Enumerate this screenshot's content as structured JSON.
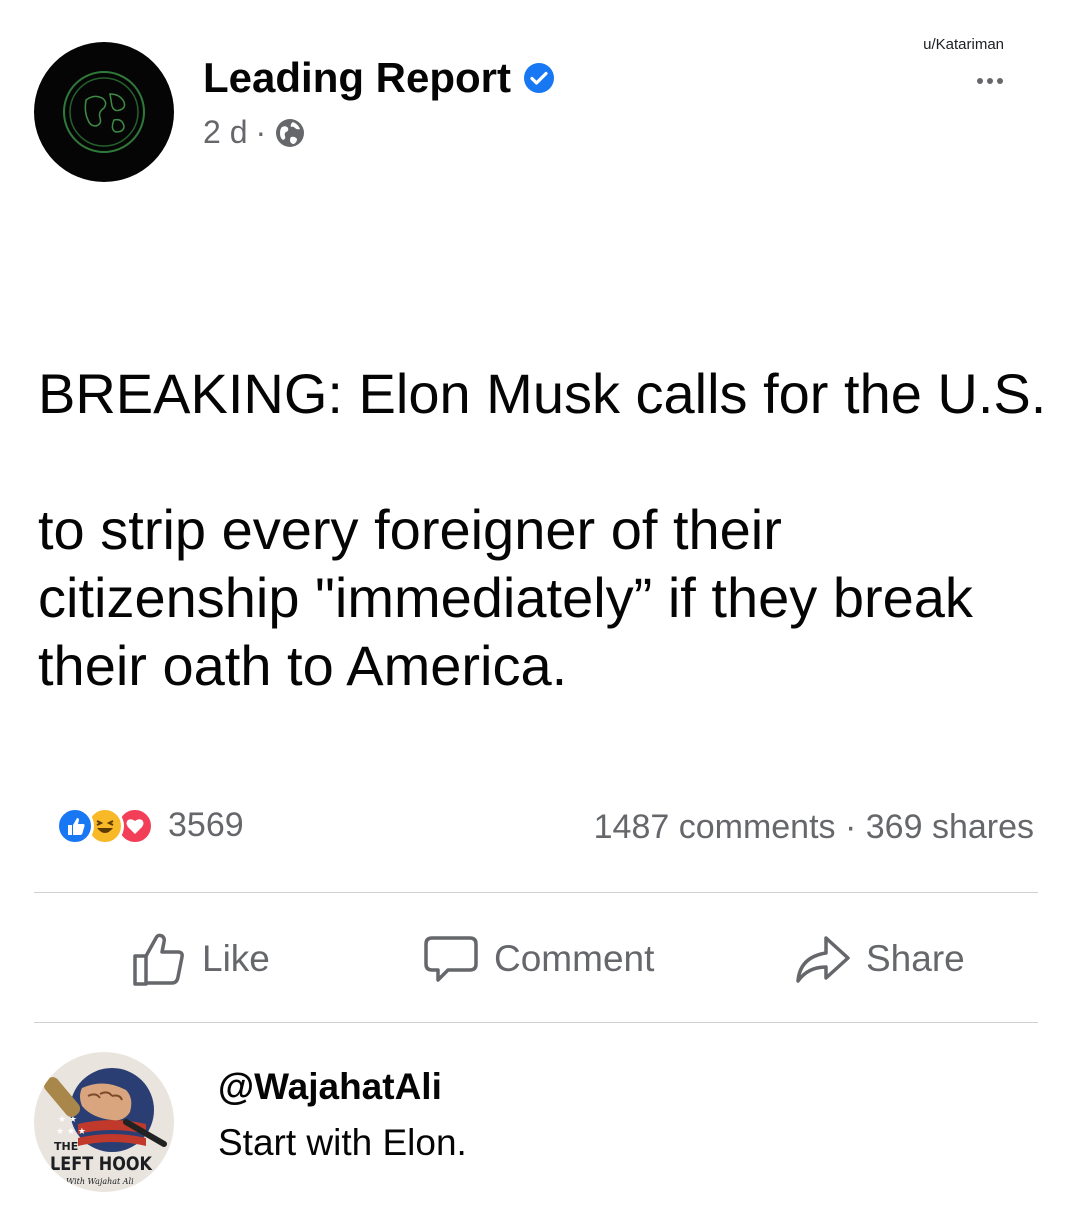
{
  "watermark": "u/Katariman",
  "post": {
    "page_name": "Leading Report",
    "verified": true,
    "time": "2 d",
    "separator": "·",
    "privacy_icon": "globe-icon",
    "text": "BREAKING: Elon Musk calls for the U.S.\n\nto strip every foreigner of their citizenship \"immediately” if they break their oath to America."
  },
  "engagement": {
    "reaction_icons": [
      "like-reaction-icon",
      "haha-reaction-icon",
      "love-reaction-icon"
    ],
    "reaction_count": "3569",
    "comments": "1487 comments",
    "stats_separator": " · ",
    "shares": "369 shares"
  },
  "actions": {
    "like": "Like",
    "comment": "Comment",
    "share": "Share"
  },
  "comment": {
    "handle": "@WajahatAli",
    "text": "Start with Elon.",
    "avatar_logo_lines": [
      "THE",
      "LEFT HOOK",
      "With Wajahat Ali"
    ]
  },
  "colors": {
    "brand_blue": "#1877f2",
    "secondary_text": "#65676b",
    "primary_text": "#050505",
    "divider": "#ced0d4",
    "love_red": "#f33e58",
    "haha_yellow": "#f7b928"
  }
}
